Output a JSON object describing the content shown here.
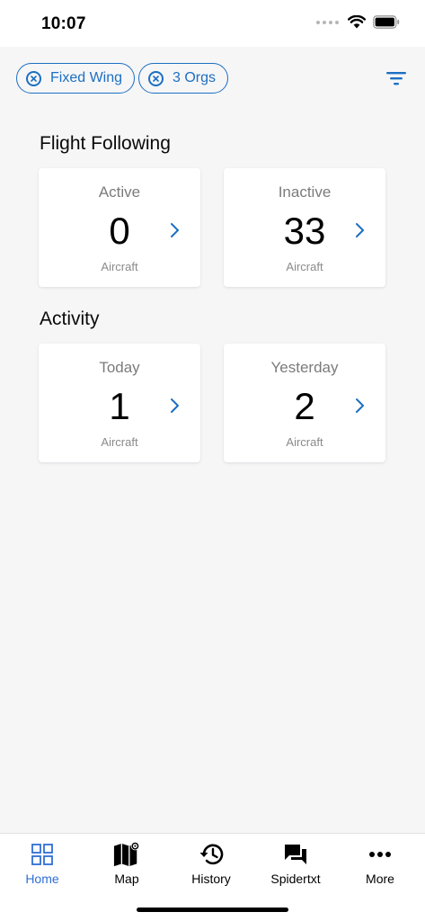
{
  "status_bar": {
    "time": "10:07"
  },
  "filters": {
    "chips": [
      {
        "label": "Fixed Wing"
      },
      {
        "label": "3 Orgs"
      }
    ]
  },
  "flight_following": {
    "title": "Flight Following",
    "cards": [
      {
        "label": "Active",
        "value": "0",
        "unit": "Aircraft"
      },
      {
        "label": "Inactive",
        "value": "33",
        "unit": "Aircraft"
      }
    ]
  },
  "activity": {
    "title": "Activity",
    "cards": [
      {
        "label": "Today",
        "value": "1",
        "unit": "Aircraft"
      },
      {
        "label": "Yesterday",
        "value": "2",
        "unit": "Aircraft"
      }
    ]
  },
  "tab_bar": {
    "active": "Home",
    "tabs": [
      {
        "label": "Home",
        "icon": "grid-icon"
      },
      {
        "label": "Map",
        "icon": "map-icon"
      },
      {
        "label": "History",
        "icon": "history-icon"
      },
      {
        "label": "Spidertxt",
        "icon": "chat-icon"
      },
      {
        "label": "More",
        "icon": "more-icon"
      }
    ]
  },
  "colors": {
    "accent": "#1c6fc2",
    "tab_active": "#2f6fd4",
    "background": "#f6f6f7",
    "card": "#ffffff"
  }
}
